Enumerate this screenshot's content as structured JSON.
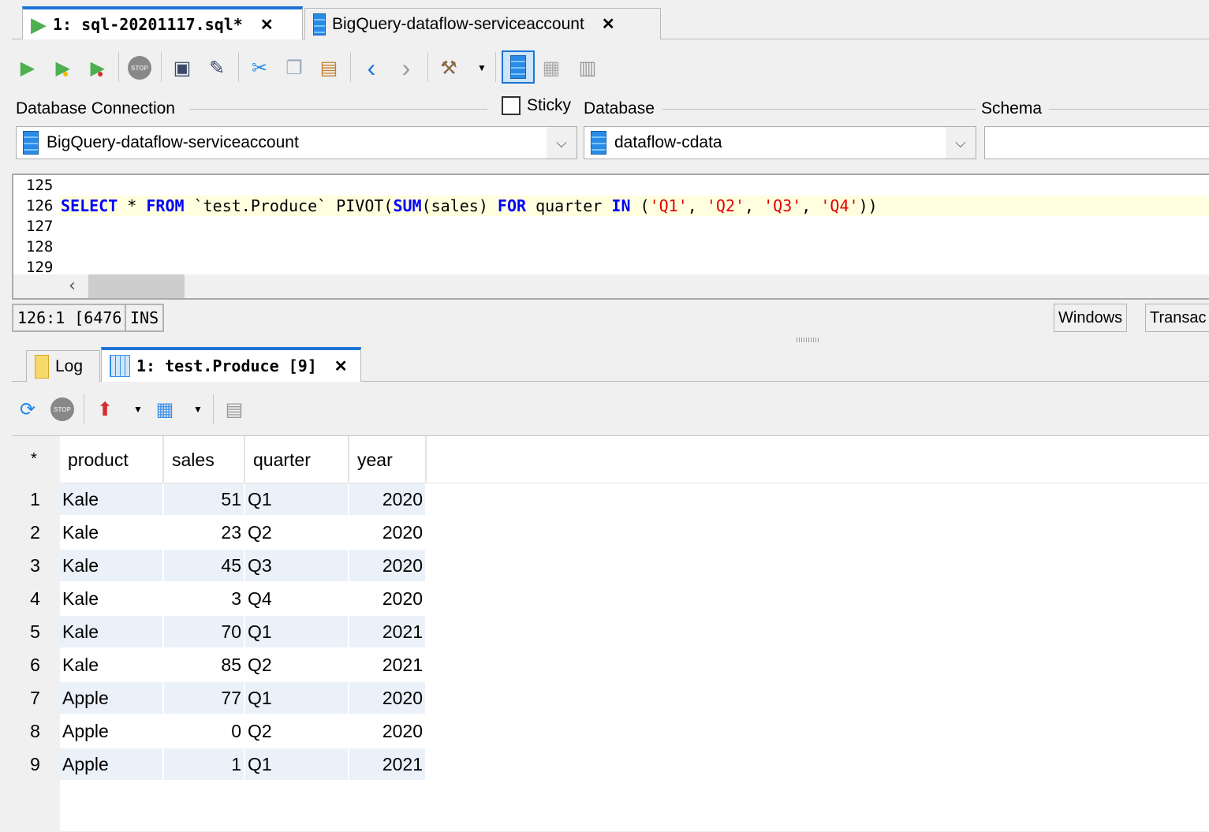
{
  "tabs": [
    {
      "label": "1: sql-20201117.sql*",
      "active": true
    },
    {
      "label": "BigQuery-dataflow-serviceaccount",
      "active": false
    }
  ],
  "toolbar_icons": [
    "execute-icon",
    "execute-current-icon",
    "execute-step-icon",
    "stop-icon",
    "save-icon",
    "save-as-icon",
    "cut-icon",
    "copy-icon",
    "paste-icon",
    "back-icon",
    "forward-icon",
    "tools-icon",
    "db-explorer-icon",
    "table-icon",
    "schema-icon"
  ],
  "connection": {
    "db_connection_label": "Database Connection",
    "sticky_label": "Sticky",
    "sticky_checked": false,
    "database_label": "Database",
    "schema_label": "Schema",
    "connection_value": "BigQuery-dataflow-serviceaccount",
    "database_value": "dataflow-cdata",
    "schema_value": ""
  },
  "editor": {
    "line_numbers": [
      "125",
      "126",
      "127",
      "128",
      "129"
    ],
    "tokens": [
      {
        "t": "SELECT",
        "c": "kw"
      },
      {
        "t": " * ",
        "c": ""
      },
      {
        "t": "FROM",
        "c": "kw"
      },
      {
        "t": " `test.Produce` PIVOT(",
        "c": ""
      },
      {
        "t": "SUM",
        "c": "kw"
      },
      {
        "t": "(sales) ",
        "c": ""
      },
      {
        "t": "FOR",
        "c": "kw"
      },
      {
        "t": " quarter ",
        "c": ""
      },
      {
        "t": "IN",
        "c": "kw"
      },
      {
        "t": " (",
        "c": ""
      },
      {
        "t": "'Q1'",
        "c": "str"
      },
      {
        "t": ", ",
        "c": ""
      },
      {
        "t": "'Q2'",
        "c": "str"
      },
      {
        "t": ", ",
        "c": ""
      },
      {
        "t": "'Q3'",
        "c": "str"
      },
      {
        "t": ", ",
        "c": ""
      },
      {
        "t": "'Q4'",
        "c": "str"
      },
      {
        "t": "))",
        "c": ""
      }
    ]
  },
  "status": {
    "position": "126:1 [6476]",
    "mode": "INS",
    "windows_button": "Windows",
    "transaction_button": "Transac"
  },
  "result_tabs": [
    {
      "label": "Log"
    },
    {
      "label": "1: test.Produce [9]"
    }
  ],
  "grid": {
    "corner": "*",
    "columns": [
      "product",
      "sales",
      "quarter",
      "year"
    ],
    "rows": [
      [
        "1",
        "Kale",
        "51",
        "Q1",
        "2020"
      ],
      [
        "2",
        "Kale",
        "23",
        "Q2",
        "2020"
      ],
      [
        "3",
        "Kale",
        "45",
        "Q3",
        "2020"
      ],
      [
        "4",
        "Kale",
        "3",
        "Q4",
        "2020"
      ],
      [
        "5",
        "Kale",
        "70",
        "Q1",
        "2021"
      ],
      [
        "6",
        "Kale",
        "85",
        "Q2",
        "2021"
      ],
      [
        "7",
        "Apple",
        "77",
        "Q1",
        "2020"
      ],
      [
        "8",
        "Apple",
        "0",
        "Q2",
        "2020"
      ],
      [
        "9",
        "Apple",
        "1",
        "Q1",
        "2021"
      ]
    ]
  }
}
